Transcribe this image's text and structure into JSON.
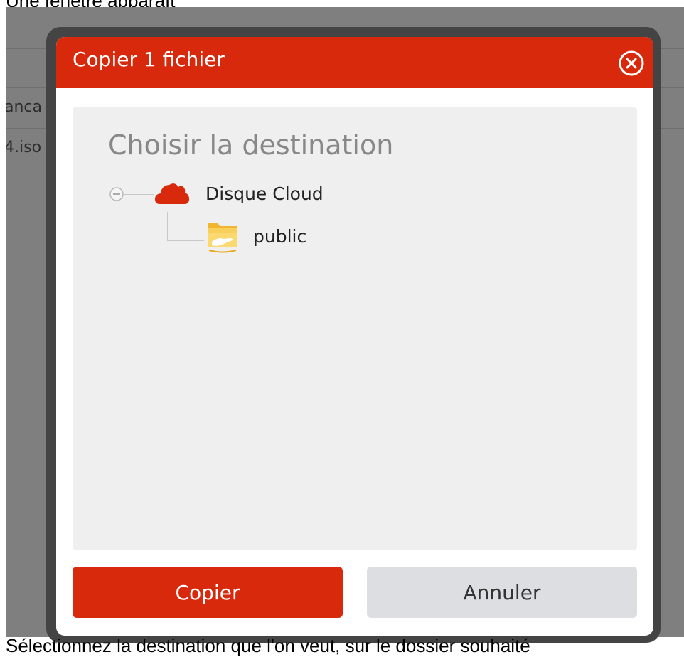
{
  "captions": {
    "top": "Une fenêtre apparaît",
    "bottom": "Sélectionnez la destination que l'on veut, sur le dossier souhaité"
  },
  "background": {
    "row1_text": "anca",
    "row2_text": "4.iso"
  },
  "dialog": {
    "title": "Copier 1 fichier",
    "close_icon": "close-circle-icon",
    "heading": "Choisir la destination",
    "tree": {
      "root": {
        "label": "Disque Cloud",
        "icon": "cloud-icon",
        "expanded": true
      },
      "children": [
        {
          "label": "public",
          "icon": "shared-folder-icon"
        }
      ]
    },
    "buttons": {
      "primary": "Copier",
      "secondary": "Annuler"
    }
  },
  "colors": {
    "accent": "#d9290c",
    "folder": "#f5c34a",
    "secondary_button": "#dcdee2"
  }
}
